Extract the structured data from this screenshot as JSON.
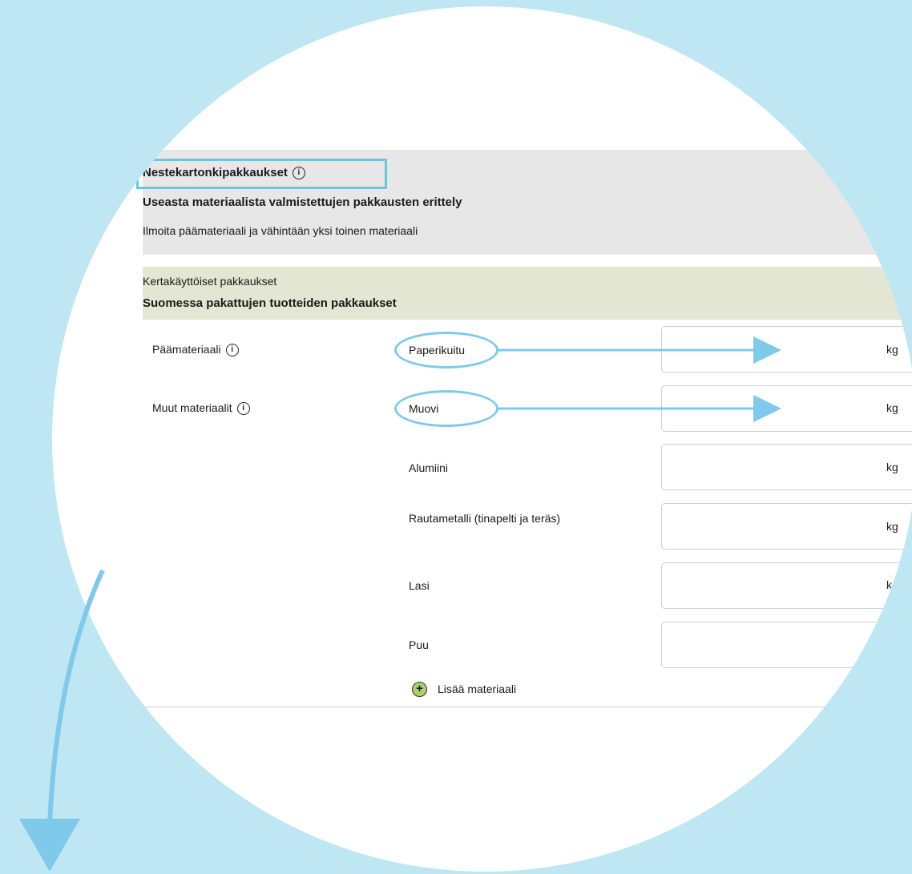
{
  "section": {
    "title": "Nestekartonkipakkaukset",
    "subtitle": "Useasta materiaalista valmistettujen pakkausten erittely",
    "description": "Ilmoita päämateriaali ja vähintään yksi toinen materiaali"
  },
  "subsection": {
    "line1": "Kertakäyttöiset pakkaukset",
    "line2": "Suomessa pakattujen tuotteiden pakkaukset"
  },
  "rows": {
    "main_label": "Päämateriaali",
    "other_label": "Muut materiaalit"
  },
  "materials": [
    {
      "name": "Paperikuitu",
      "unit": "kg"
    },
    {
      "name": "Muovi",
      "unit": "kg"
    },
    {
      "name": "Alumiini",
      "unit": "kg"
    },
    {
      "name": "Rautametalli (tinapelti ja teräs)",
      "unit": "kg"
    },
    {
      "name": "Lasi",
      "unit": "k"
    },
    {
      "name": "Puu",
      "unit": ""
    }
  ],
  "add_material_label": "Lisää materiaali",
  "info_glyph": "i",
  "add_glyph": "+",
  "colors": {
    "background": "#bfe6f3",
    "highlight": "#6ec4e6",
    "arrow": "#7fc9ea",
    "header_bg": "#e7e7e7",
    "green_bg": "#e2e6d3",
    "add_icon": "#a8d26b"
  }
}
